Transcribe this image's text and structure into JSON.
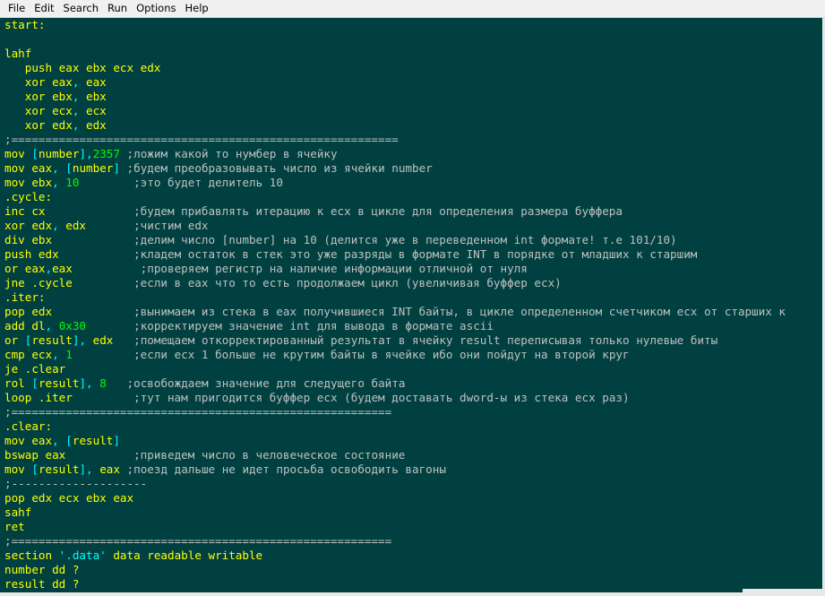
{
  "menu": [
    "File",
    "Edit",
    "Search",
    "Run",
    "Options",
    "Help"
  ],
  "colors": {
    "background": "#004040",
    "code": "#ffff00",
    "comment": "#c0c0c0",
    "literal": "#00ff00",
    "bracket": "#00ffff"
  },
  "code_lines": [
    [
      [
        "start:",
        "code"
      ]
    ],
    [],
    [
      [
        "lahf",
        "code"
      ]
    ],
    [
      [
        "   push eax ebx ecx edx",
        "code"
      ]
    ],
    [
      [
        "   xor eax",
        "code"
      ],
      [
        ",",
        "br"
      ],
      [
        " eax",
        "code"
      ]
    ],
    [
      [
        "   xor ebx",
        "code"
      ],
      [
        ",",
        "br"
      ],
      [
        " ebx",
        "code"
      ]
    ],
    [
      [
        "   xor ecx",
        "code"
      ],
      [
        ",",
        "br"
      ],
      [
        " ecx",
        "code"
      ]
    ],
    [
      [
        "   xor edx",
        "code"
      ],
      [
        ",",
        "br"
      ],
      [
        " edx",
        "code"
      ]
    ],
    [
      [
        ";=========================================================",
        "com"
      ]
    ],
    [
      [
        "mov ",
        "code"
      ],
      [
        "[",
        "br"
      ],
      [
        "number",
        "code"
      ],
      [
        "]",
        "br"
      ],
      [
        ",",
        "br"
      ],
      [
        "2357",
        "lit"
      ],
      [
        " ;ложим какой то нумбер в ячейку",
        "com"
      ]
    ],
    [
      [
        "mov eax",
        "code"
      ],
      [
        ",",
        "br"
      ],
      [
        " ",
        "code"
      ],
      [
        "[",
        "br"
      ],
      [
        "number",
        "code"
      ],
      [
        "]",
        "br"
      ],
      [
        " ;будем преобразовывать число из ячейки number",
        "com"
      ]
    ],
    [
      [
        "mov ebx",
        "code"
      ],
      [
        ",",
        "br"
      ],
      [
        " ",
        "code"
      ],
      [
        "10",
        "lit"
      ],
      [
        "        ;это будет делитель 10",
        "com"
      ]
    ],
    [
      [
        ".cycle:",
        "code"
      ]
    ],
    [
      [
        "inc cx",
        "code"
      ],
      [
        "             ;будем прибавлять итерацию к ecx в цикле для определения размера буффера",
        "com"
      ]
    ],
    [
      [
        "xor edx",
        "code"
      ],
      [
        ",",
        "br"
      ],
      [
        " edx",
        "code"
      ],
      [
        "       ;чистим edx",
        "com"
      ]
    ],
    [
      [
        "div ebx",
        "code"
      ],
      [
        "            ;делим число [number] на 10 (делится уже в переведенном int формате! т.е 101/10)",
        "com"
      ]
    ],
    [
      [
        "push edx",
        "code"
      ],
      [
        "           ;кладем остаток в стек это уже разряды в формате INT в порядке от младших к старшим",
        "com"
      ]
    ],
    [
      [
        "or eax",
        "code"
      ],
      [
        ",",
        "br"
      ],
      [
        "eax",
        "code"
      ],
      [
        "          ;проверяем регистр на наличие информации отличной от нуля",
        "com"
      ]
    ],
    [
      [
        "jne .cycle",
        "code"
      ],
      [
        "         ;если в eax что то есть продолжаем цикл (увеличивая буффер ecx)",
        "com"
      ]
    ],
    [
      [
        ".iter:",
        "code"
      ]
    ],
    [
      [
        "pop edx",
        "code"
      ],
      [
        "            ;вынимаем из стека в eax получившиеся INT байты, в цикле определенном счетчиком ecx от старших к",
        "com"
      ]
    ],
    [
      [
        "add dl",
        "code"
      ],
      [
        ",",
        "br"
      ],
      [
        " ",
        "code"
      ],
      [
        "0x30",
        "lit"
      ],
      [
        "       ;корректируем значение int для вывода в формате ascii",
        "com"
      ]
    ],
    [
      [
        "or ",
        "code"
      ],
      [
        "[",
        "br"
      ],
      [
        "result",
        "code"
      ],
      [
        "]",
        "br"
      ],
      [
        ",",
        "br"
      ],
      [
        " edx",
        "code"
      ],
      [
        "   ;помещаем откорректированный результат в ячейку result переписывая только нулевые биты",
        "com"
      ]
    ],
    [
      [
        "cmp ecx",
        "code"
      ],
      [
        ",",
        "br"
      ],
      [
        " ",
        "code"
      ],
      [
        "1",
        "lit"
      ],
      [
        "         ;если ecx 1 больше не крутим байты в ячейке ибо они пойдут на второй круг",
        "com"
      ]
    ],
    [
      [
        "je .clear",
        "code"
      ]
    ],
    [
      [
        "rol ",
        "code"
      ],
      [
        "[",
        "br"
      ],
      [
        "result",
        "code"
      ],
      [
        "]",
        "br"
      ],
      [
        ",",
        "br"
      ],
      [
        " ",
        "code"
      ],
      [
        "8",
        "lit"
      ],
      [
        "   ;освобождаем значение для следущего байта",
        "com"
      ]
    ],
    [
      [
        "loop .iter",
        "code"
      ],
      [
        "         ;тут нам пригодится буффер ecx (будем доставать dword-ы из стека ecx раз)",
        "com"
      ]
    ],
    [
      [
        ";========================================================",
        "com"
      ]
    ],
    [
      [
        ".clear:",
        "code"
      ]
    ],
    [
      [
        "mov eax",
        "code"
      ],
      [
        ",",
        "br"
      ],
      [
        " ",
        "code"
      ],
      [
        "[",
        "br"
      ],
      [
        "result",
        "code"
      ],
      [
        "]",
        "br"
      ]
    ],
    [
      [
        "bswap eax",
        "code"
      ],
      [
        "          ;приведем число в человеческое состояние",
        "com"
      ]
    ],
    [
      [
        "mov ",
        "code"
      ],
      [
        "[",
        "br"
      ],
      [
        "result",
        "code"
      ],
      [
        "]",
        "br"
      ],
      [
        ",",
        "br"
      ],
      [
        " eax",
        "code"
      ],
      [
        " ;поезд дальше не идет просьба освободить вагоны",
        "com"
      ]
    ],
    [
      [
        ";--------------------",
        "com"
      ]
    ],
    [
      [
        "pop edx ecx ebx eax",
        "code"
      ]
    ],
    [
      [
        "sahf",
        "code"
      ]
    ],
    [
      [
        "ret",
        "code"
      ]
    ],
    [
      [
        ";========================================================",
        "com"
      ]
    ],
    [
      [
        "section ",
        "code"
      ],
      [
        "'.data'",
        "str"
      ],
      [
        " data readable writable",
        "code"
      ]
    ],
    [
      [
        "number dd ?",
        "code"
      ]
    ],
    [
      [
        "result dd ?",
        "code"
      ]
    ]
  ]
}
